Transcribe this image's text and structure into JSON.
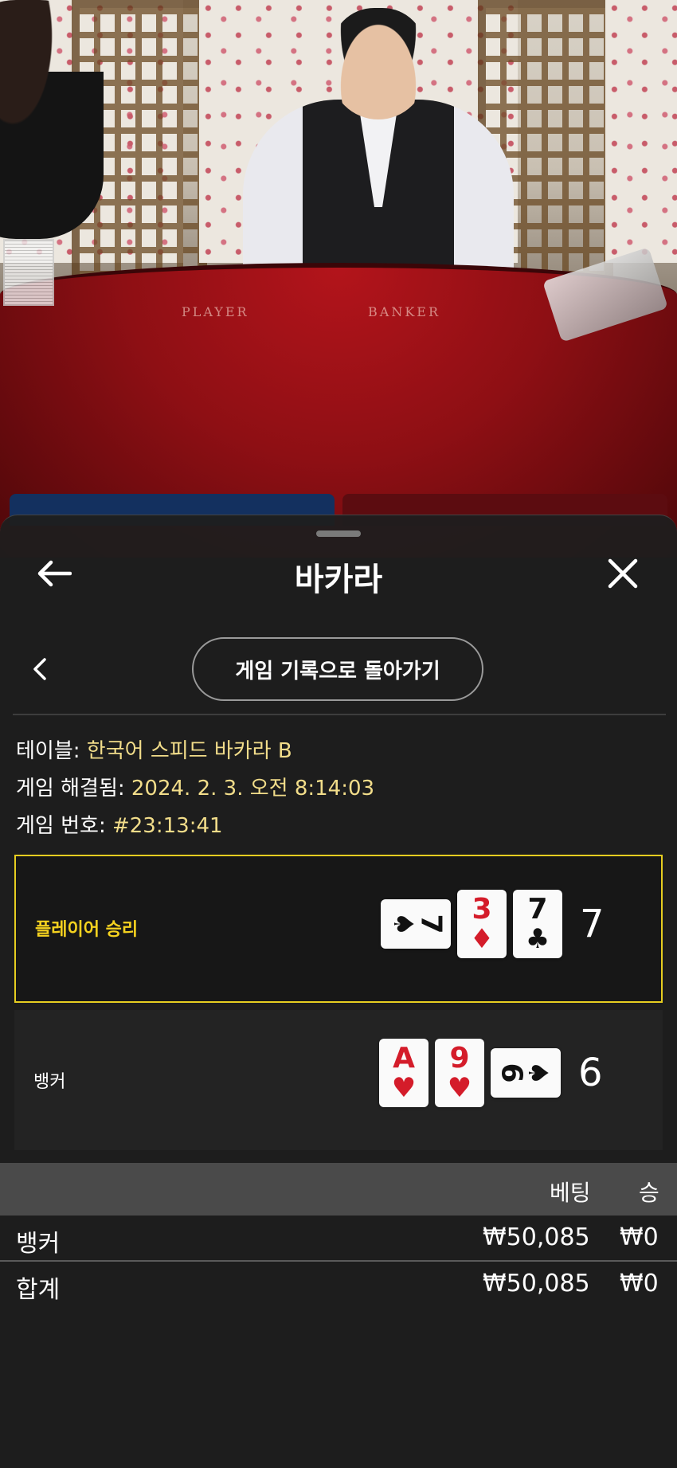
{
  "video": {
    "felt_player_label": "PLAYER",
    "felt_banker_label": "BANKER"
  },
  "sheet": {
    "title": "바카라",
    "back_icon": "arrow-left-icon",
    "close_icon": "close-icon",
    "prev_icon": "chevron-left-icon",
    "history_button_label": "게임 기록으로 돌아가기"
  },
  "info": {
    "table_label": "테이블:",
    "table_value": " 한국어 스피드 바카라 B",
    "resolved_label": "게임 해결됨:",
    "resolved_value": " 2024. 2. 3. 오전 8:14:03",
    "game_no_label": "게임 번호:",
    "game_no_value": " #23:13:41"
  },
  "result": {
    "player": {
      "label": "플레이어 승리",
      "score": "7",
      "cards": [
        {
          "rank": "7",
          "suit": "♠",
          "color": "black",
          "rotated": true
        },
        {
          "rank": "3",
          "suit": "♦",
          "color": "red",
          "rotated": false
        },
        {
          "rank": "7",
          "suit": "♣",
          "color": "black",
          "rotated": false
        }
      ]
    },
    "banker": {
      "label": "뱅커",
      "score": "6",
      "cards": [
        {
          "rank": "A",
          "suit": "♥",
          "color": "red",
          "rotated": false
        },
        {
          "rank": "9",
          "suit": "♥",
          "color": "red",
          "rotated": false
        },
        {
          "rank": "6",
          "suit": "♠",
          "color": "black",
          "rotated": true
        }
      ]
    }
  },
  "bets": {
    "header_bet": "베팅",
    "header_win": "승",
    "rows": [
      {
        "name": "뱅커",
        "bet": "₩50,085",
        "win": "₩0"
      },
      {
        "name": "합계",
        "bet": "₩50,085",
        "win": "₩0"
      }
    ]
  },
  "colors": {
    "accent_gold": "#f5d21f",
    "value_text": "#f2dd8a",
    "card_red": "#d41c2a"
  }
}
